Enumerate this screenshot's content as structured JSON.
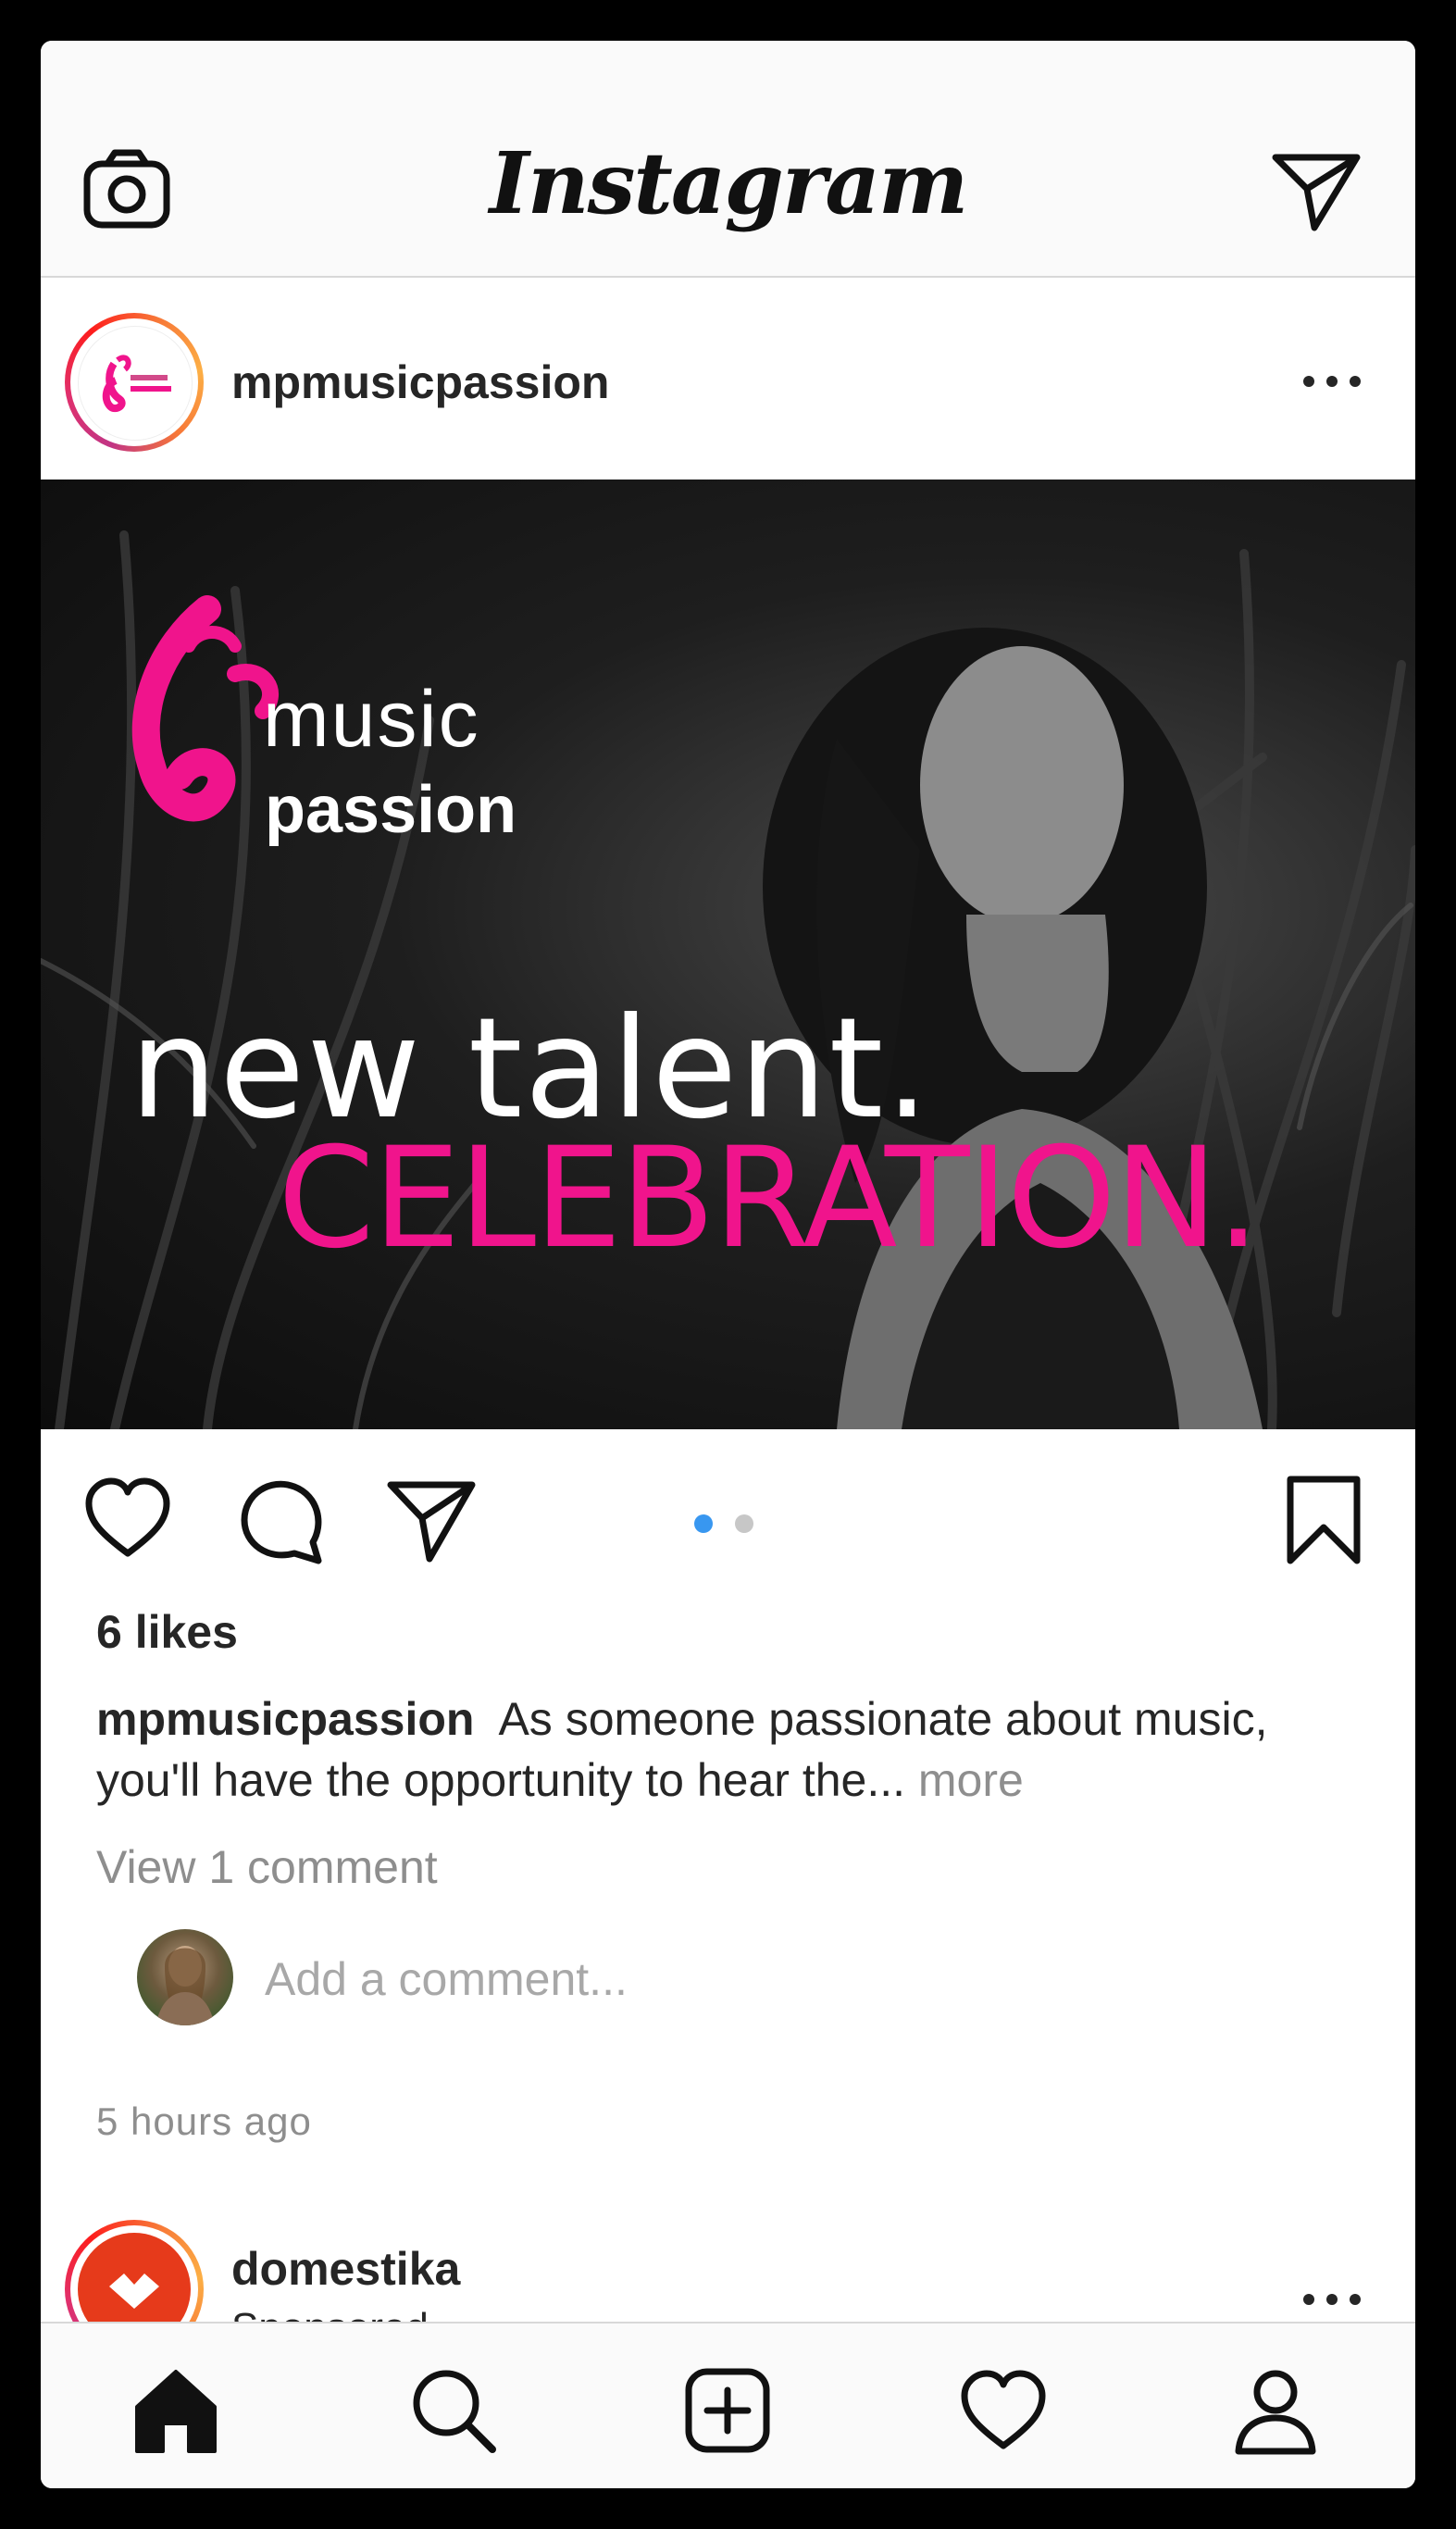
{
  "app": {
    "title": "Instagram"
  },
  "icons": {
    "camera": "camera-icon",
    "direct": "paper-plane-icon",
    "like": "heart-icon",
    "comment": "speech-bubble-icon",
    "share": "paper-plane-icon",
    "save": "bookmark-icon",
    "home": "home-icon",
    "search": "search-icon",
    "new_post": "plus-square-icon",
    "activity": "heart-icon",
    "profile": "person-icon"
  },
  "post": {
    "username": "mpmusicpassion",
    "image": {
      "brand_line1": "music",
      "brand_line2": "passion",
      "headline_line1": "new talent.",
      "headline_line2": "CELEBRATION."
    },
    "carousel": {
      "count": 2,
      "active": 1
    },
    "likes": "6 likes",
    "caption_user": "mpmusicpassion",
    "caption_text": "As someone passionate about music, you'll have the opportunity to hear the...",
    "caption_more": "more",
    "view_comments": "View 1 comment",
    "comment_placeholder": "Add a comment...",
    "timestamp": "5 hours ago"
  },
  "next_post": {
    "username": "domestika",
    "label": "Sponsored"
  },
  "colors": {
    "accent_pink": "#f0148c",
    "link_blue": "#3897f0",
    "muted_text": "#8e8e8e",
    "domestika_red": "#e63a1b"
  }
}
